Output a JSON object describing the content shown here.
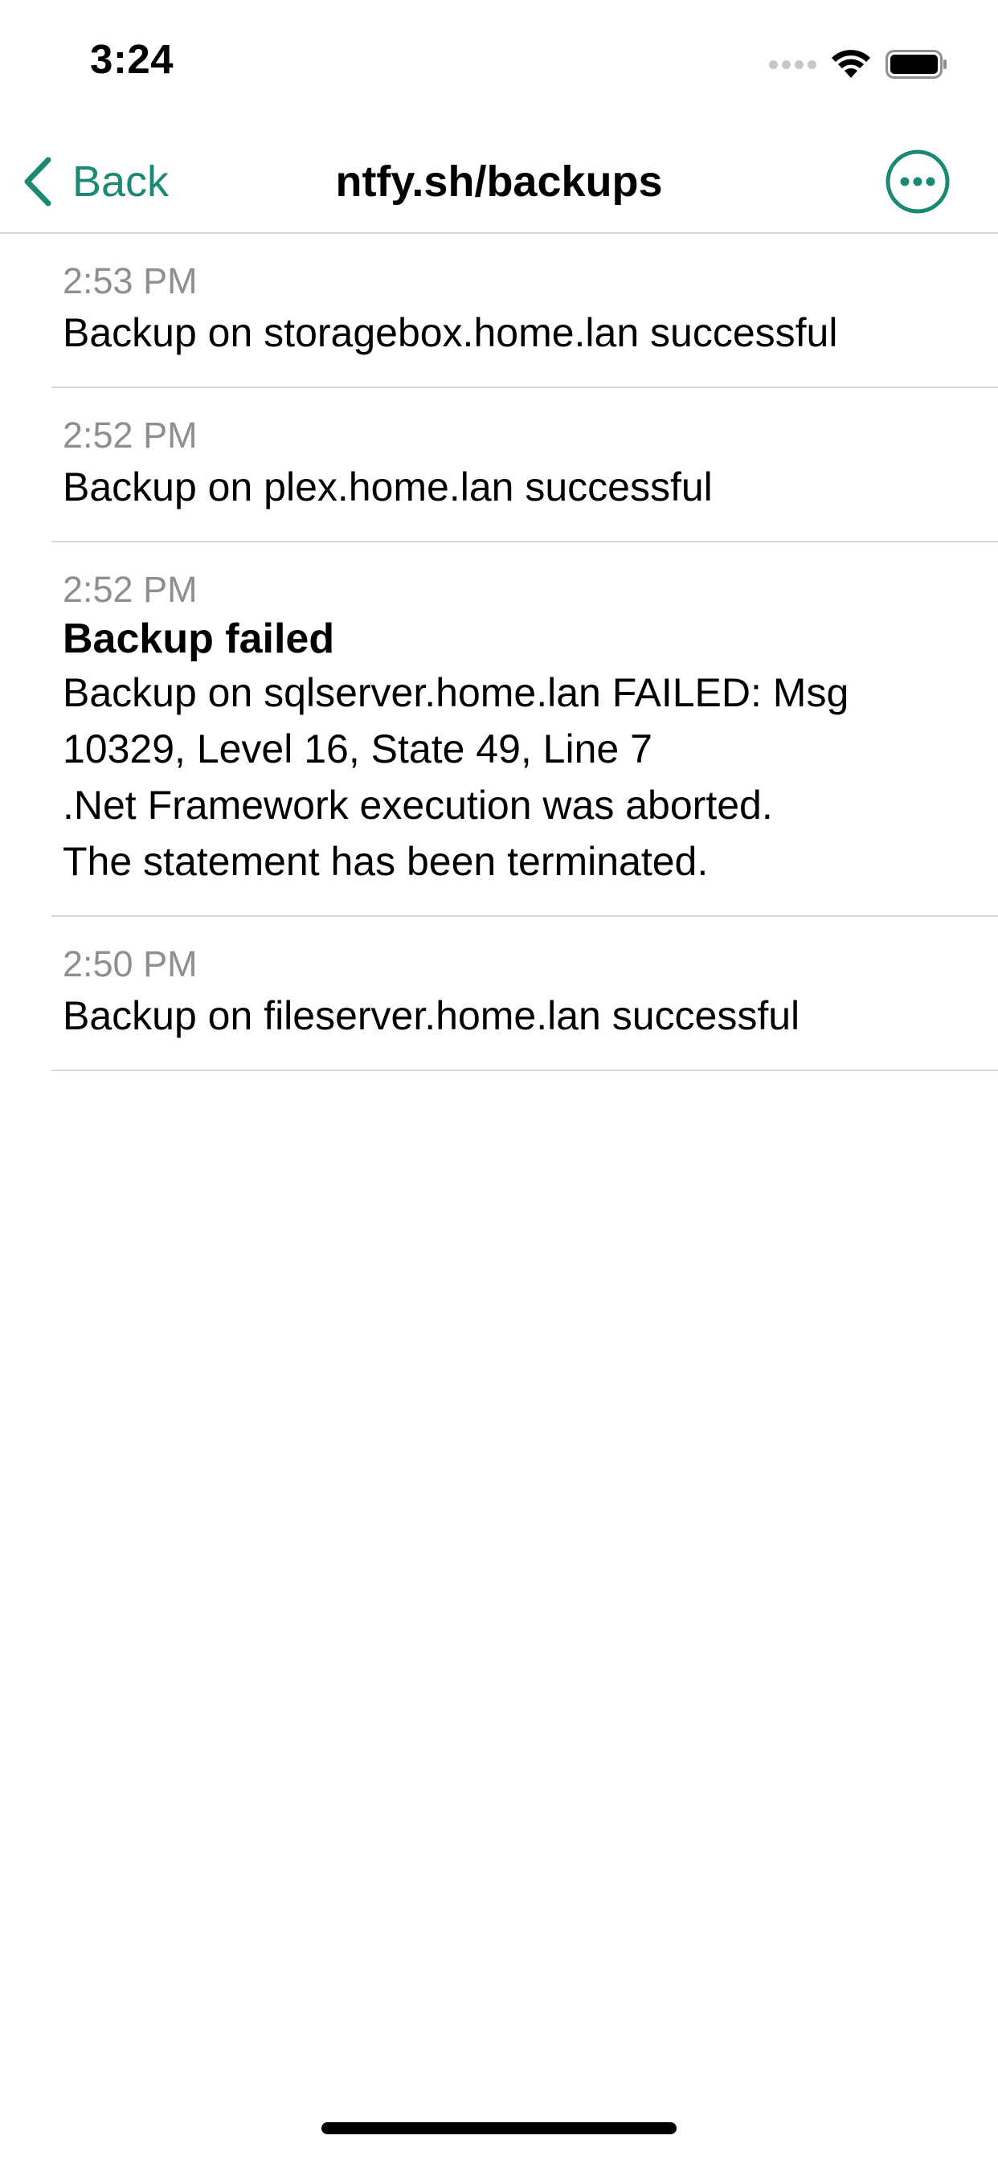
{
  "status_bar": {
    "time": "3:24"
  },
  "nav": {
    "back_label": "Back",
    "title": "ntfy.sh/backups",
    "accent_color": "#1a8a74"
  },
  "messages": [
    {
      "time": "2:53 PM",
      "title": "",
      "body": "Backup on storagebox.home.lan successful"
    },
    {
      "time": "2:52 PM",
      "title": "",
      "body": "Backup on plex.home.lan successful"
    },
    {
      "time": "2:52 PM",
      "title": "Backup failed",
      "body": "Backup on sqlserver.home.lan FAILED: Msg 10329, Level 16, State 49, Line 7\n.Net Framework execution was aborted.\nThe statement has been terminated."
    },
    {
      "time": "2:50 PM",
      "title": "",
      "body": "Backup on fileserver.home.lan successful"
    }
  ],
  "icons": {
    "back": "chevron-left-icon",
    "more": "ellipsis-circle-icon",
    "wifi": "wifi-icon",
    "battery": "battery-icon",
    "signal": "cellular-signal-icon"
  }
}
